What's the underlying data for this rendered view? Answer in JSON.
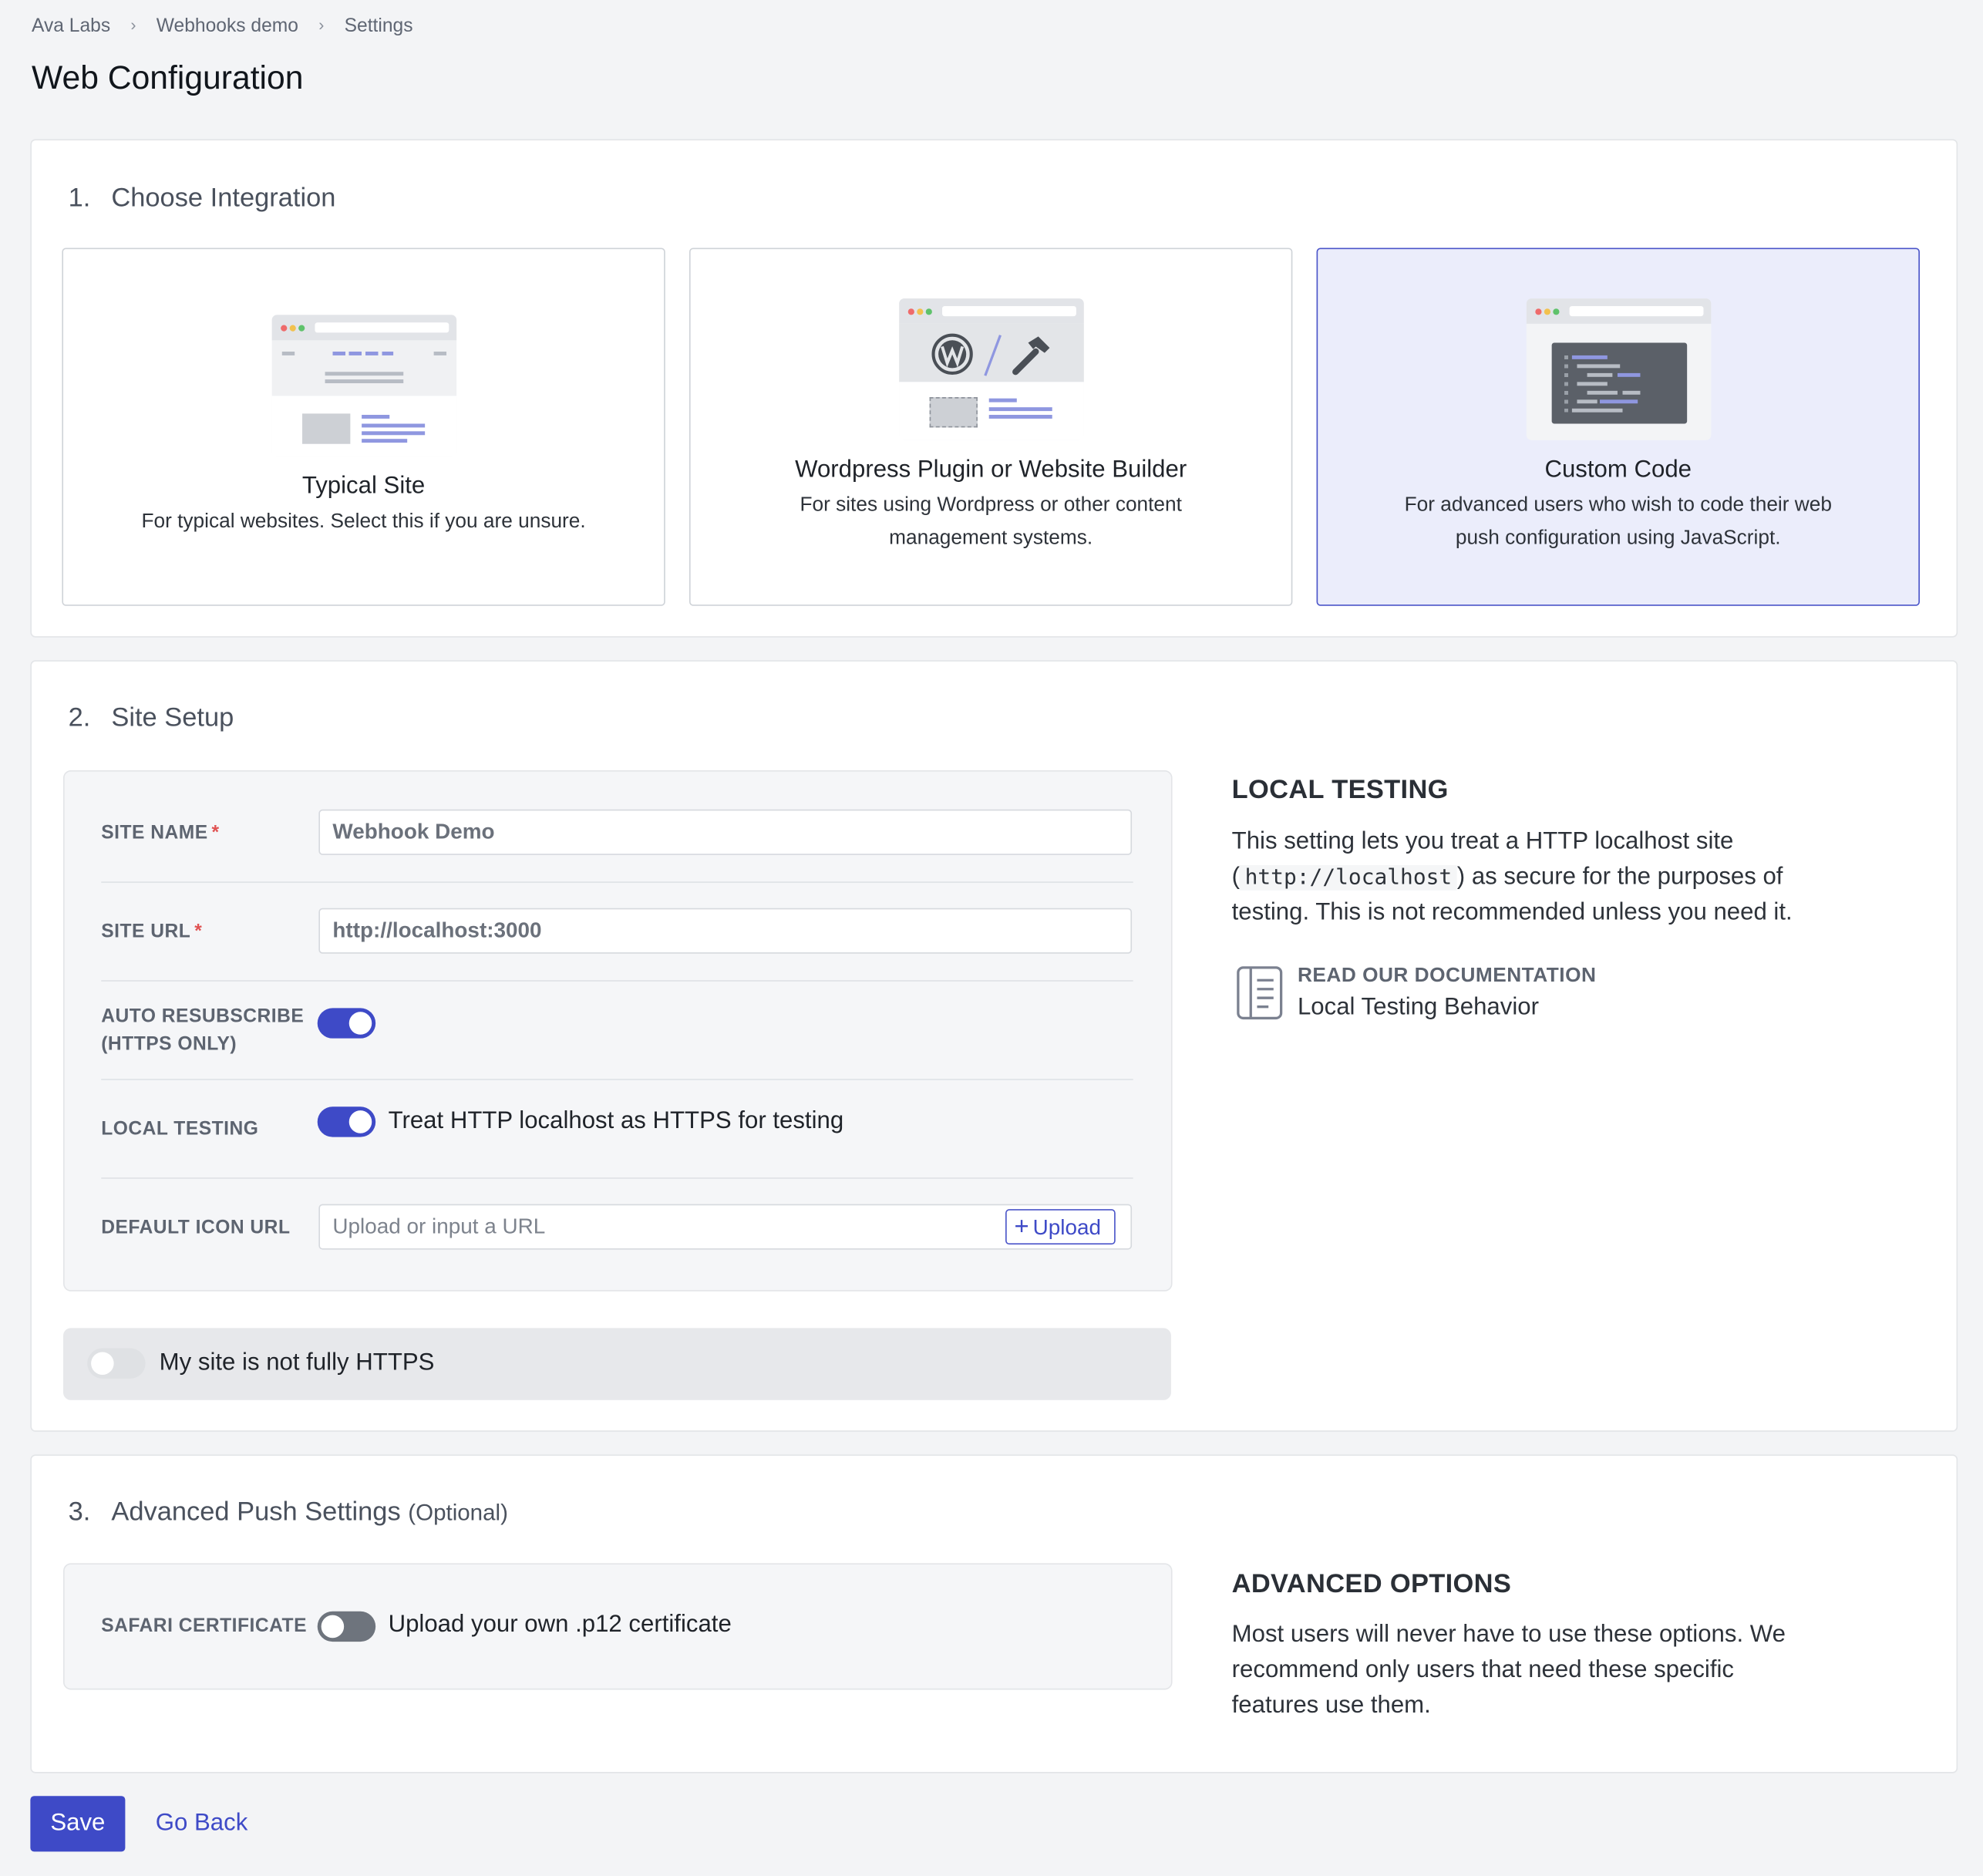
{
  "breadcrumb": {
    "items": [
      "Ava Labs",
      "Webhooks demo",
      "Settings"
    ],
    "separator": "›"
  },
  "page": {
    "title": "Web Configuration"
  },
  "integration": {
    "number": "1.",
    "title": "Choose Integration",
    "options": [
      {
        "title": "Typical Site",
        "description": "For typical websites. Select this if you are unsure.",
        "selected": false,
        "icon": "browser-layout-illustration"
      },
      {
        "title": "Wordpress Plugin or Website Builder",
        "description_lines": [
          "For sites using Wordpress or other content",
          "management systems."
        ],
        "selected": false,
        "icon": "wordpress-tools-illustration"
      },
      {
        "title": "Custom Code",
        "description_lines": [
          "For advanced users who wish to code their web",
          "push configuration using JavaScript."
        ],
        "selected": true,
        "icon": "code-editor-illustration"
      }
    ]
  },
  "site_setup": {
    "number": "2.",
    "title": "Site Setup",
    "site_name": {
      "label": "SITE NAME",
      "value": "Webhook Demo",
      "required": "*"
    },
    "site_url": {
      "label": "SITE URL",
      "value": "http://localhost:3000",
      "required": "*"
    },
    "auto_resubscribe": {
      "label_line1": "AUTO RESUBSCRIBE",
      "label_line2": "(HTTPS ONLY)",
      "on": true
    },
    "local_testing": {
      "label": "LOCAL TESTING",
      "on": true,
      "text": "Treat HTTP localhost as HTTPS for testing"
    },
    "default_icon": {
      "label": "DEFAULT ICON URL",
      "placeholder": "Upload or input a URL",
      "upload_label": "Upload"
    },
    "not_https": {
      "on": false,
      "text": "My site is not fully HTTPS"
    },
    "aside": {
      "heading": "LOCAL TESTING",
      "text_before": "This setting lets you treat a HTTP localhost site",
      "code": "http://localhost",
      "text_after": "as secure for the purposes of",
      "text_end": "testing. This is not recommended unless you need it.",
      "doc_caption": "READ OUR DOCUMENTATION",
      "doc_link": "Local Testing Behavior"
    }
  },
  "advanced": {
    "number": "3.",
    "title": "Advanced Push Settings",
    "optional": "(Optional)",
    "safari": {
      "label": "SAFARI CERTIFICATE",
      "on": false,
      "text": "Upload your own .p12 certificate"
    },
    "aside": {
      "heading": "ADVANCED OPTIONS",
      "lines": [
        "Most users will never have to use these options. We",
        "recommend only users that need these specific",
        "features use them."
      ]
    }
  },
  "footer": {
    "save_label": "Save",
    "back_label": "Go Back"
  },
  "colors": {
    "accent": "#3e4ac7",
    "selected_bg": "#ebedfb",
    "required": "#e05252"
  }
}
